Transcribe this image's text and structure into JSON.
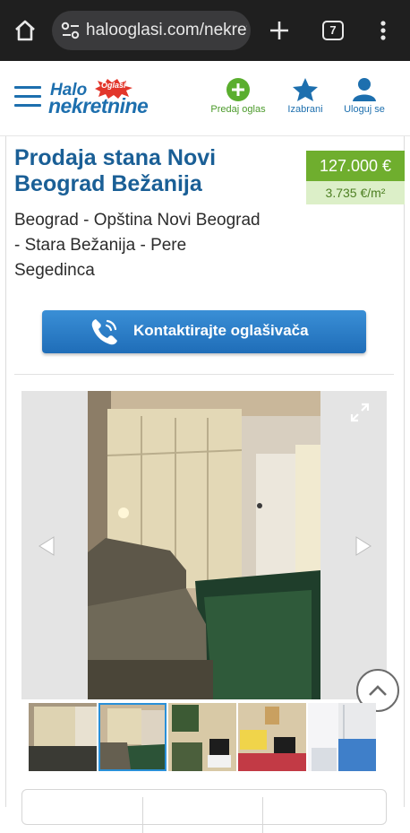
{
  "browser": {
    "url": "halooglasi.com/nekretnine",
    "tab_count": "7",
    "home_icon": "home-icon",
    "menu_icon": "more-vert-icon"
  },
  "header": {
    "logo_halo": "Halo",
    "logo_oglasi": "Oglasi",
    "logo_nekretnine": "nekretnine",
    "predaj_label": "Predaj oglas",
    "izabrani_label": "Izabrani",
    "uloguj_label": "Uloguj se",
    "accent_blue": "#1d6fae",
    "accent_green": "#4b9a2a"
  },
  "listing": {
    "title": "Prodaja stana Novi Beograd Bežanija",
    "price": "127.000 €",
    "price_per_sqm": "3.735 €/m²",
    "location": "Beograd  -  Opština Novi Beograd  -  Stara Bežanija  -  Pere Segedinca",
    "contact_label": "Kontaktirajte oglašivača"
  },
  "gallery": {
    "thumbnail_count": 5,
    "active_thumbnail": 2
  }
}
